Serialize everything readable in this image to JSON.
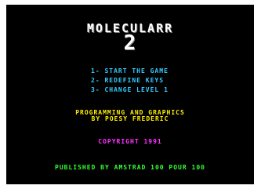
{
  "title": {
    "main": "MOLECULARR",
    "sub": "2"
  },
  "menu": {
    "items": [
      {
        "label": "1- START THE GAME"
      },
      {
        "label": "2- REDEFINE KEYS"
      },
      {
        "label": "3- CHANGE LEVEL 1"
      }
    ]
  },
  "credits": {
    "line1": "PROGRAMMING AND GRAPHICS",
    "line2": "BY POESY FREDERIC"
  },
  "copyright": "COPYRIGHT 1991",
  "publisher": "PUBLISHED BY AMSTRAD 100 POUR 100",
  "colors": {
    "background": "#000000",
    "title": "#ffffff",
    "menu": "#33ccff",
    "credits": "#ffee00",
    "copyright": "#ff33ff",
    "publisher": "#33ff33"
  }
}
